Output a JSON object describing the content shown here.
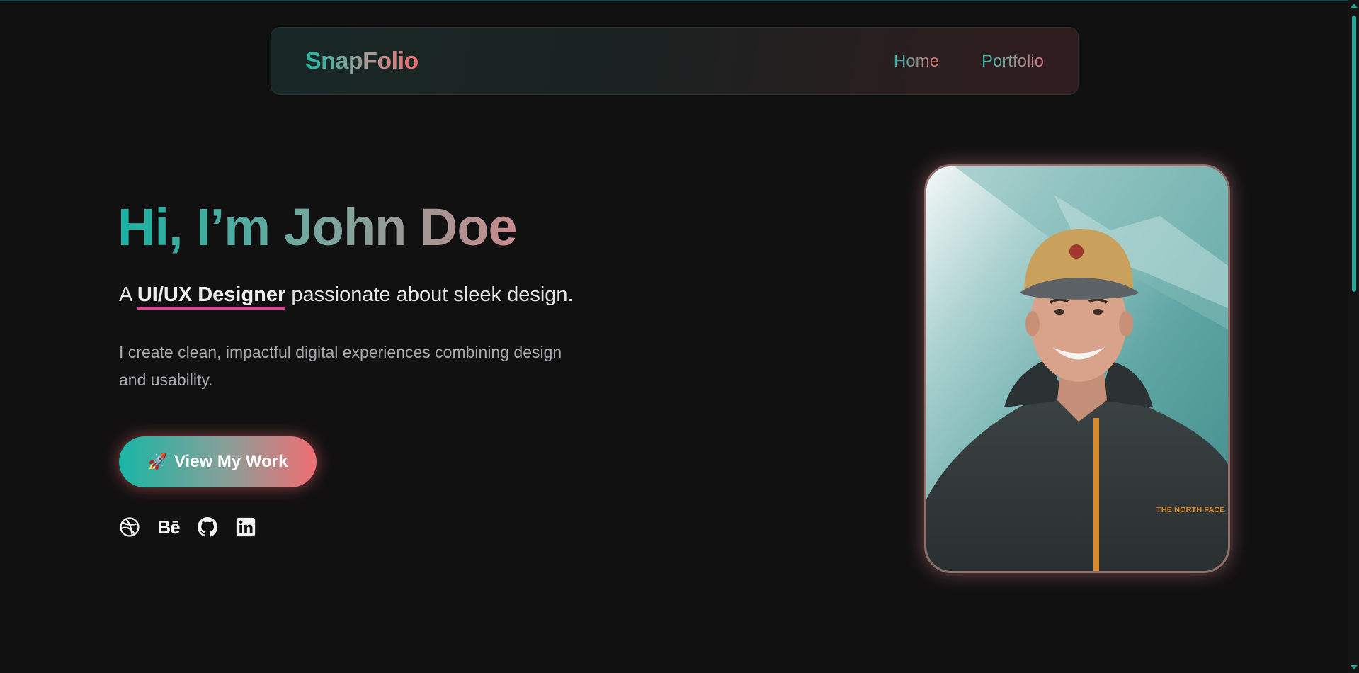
{
  "navbar": {
    "logo": "SnapFolio",
    "links": [
      "Home",
      "Portfolio"
    ]
  },
  "hero": {
    "title": "Hi, I’m John Doe",
    "tagline_prefix": "A ",
    "tagline_role": "UI/UX Designer",
    "tagline_suffix": " passionate about sleek design.",
    "description": "I create clean, impactful digital experiences combining design and usability.",
    "cta_icon": "🚀",
    "cta_label": "View My Work"
  },
  "socials": [
    {
      "icon": "dribbble-icon"
    },
    {
      "icon": "behance-icon",
      "text": "Bē"
    },
    {
      "icon": "github-icon"
    },
    {
      "icon": "linkedin-icon"
    }
  ],
  "profile_photo": {
    "jacket_logo": "THE NORTH FACE"
  },
  "colors": {
    "background": "#121112",
    "teal": "#19b6a5",
    "coral": "#f06d72",
    "underline_pink": "#e0459a"
  }
}
